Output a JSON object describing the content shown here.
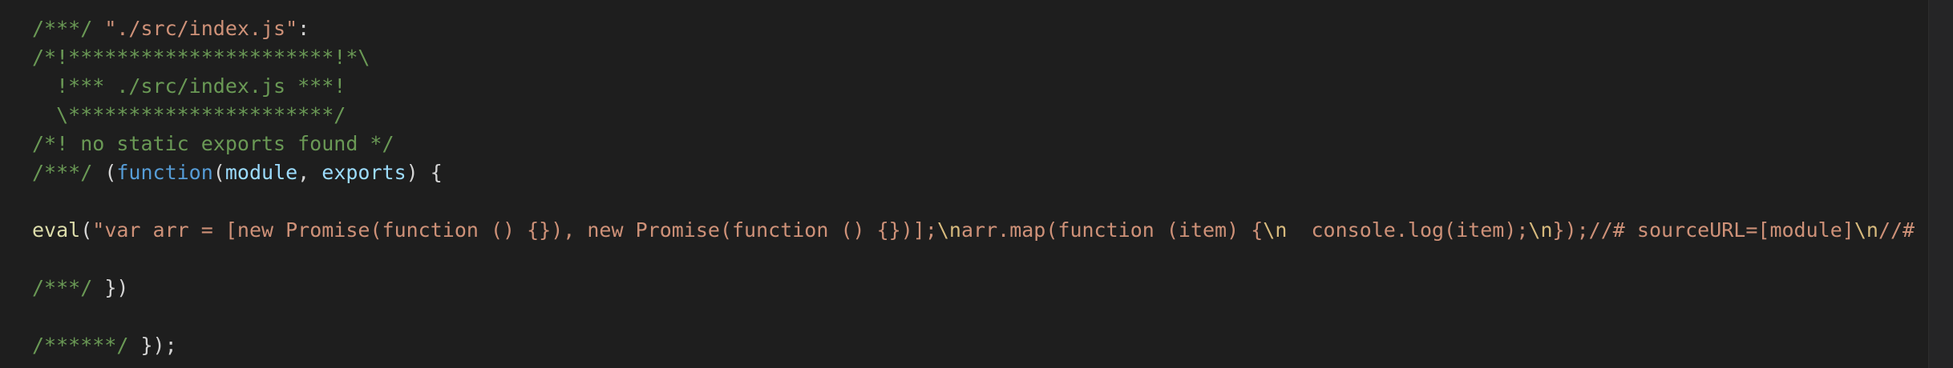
{
  "editor": {
    "background": "#1e1e1e",
    "colors": {
      "comment": "#6a9955",
      "string": "#ce9178",
      "keyword": "#569cd6",
      "param": "#9cdcfe",
      "function": "#dcdcaa",
      "default": "#d4d4d4",
      "escape": "#d7ba7d"
    },
    "lines": [
      [
        {
          "t": "/***/ ",
          "k": "comment"
        },
        {
          "t": "\"./src/index.js\"",
          "k": "string"
        },
        {
          "t": ":",
          "k": "default"
        }
      ],
      [
        {
          "t": "/*!**********************!*\\",
          "k": "comment"
        }
      ],
      [
        {
          "t": "  !*** ./src/index.js ***!",
          "k": "comment"
        }
      ],
      [
        {
          "t": "  \\**********************/",
          "k": "comment"
        }
      ],
      [
        {
          "t": "/*! no static exports found */",
          "k": "comment"
        }
      ],
      [
        {
          "t": "/***/ ",
          "k": "comment"
        },
        {
          "t": "(",
          "k": "default"
        },
        {
          "t": "function",
          "k": "keyword"
        },
        {
          "t": "(",
          "k": "default"
        },
        {
          "t": "module",
          "k": "param"
        },
        {
          "t": ", ",
          "k": "default"
        },
        {
          "t": "exports",
          "k": "param"
        },
        {
          "t": ") {",
          "k": "default"
        }
      ],
      [],
      [
        {
          "t": "eval",
          "k": "function"
        },
        {
          "t": "(",
          "k": "default"
        },
        {
          "t": "\"var arr = [new Promise(function () {}), new Promise(function () {})];",
          "k": "string"
        },
        {
          "t": "\\n",
          "k": "escape"
        },
        {
          "t": "arr.map(function (item) {",
          "k": "string"
        },
        {
          "t": "\\n",
          "k": "escape"
        },
        {
          "t": "  console.log(item);",
          "k": "string"
        },
        {
          "t": "\\n",
          "k": "escape"
        },
        {
          "t": "});//# sourceURL=[module]",
          "k": "string"
        },
        {
          "t": "\\n",
          "k": "escape"
        },
        {
          "t": "//# sourceMa",
          "k": "string"
        }
      ],
      [],
      [
        {
          "t": "/***/ ",
          "k": "comment"
        },
        {
          "t": "})",
          "k": "default"
        }
      ],
      [],
      [
        {
          "t": "/******/ ",
          "k": "comment"
        },
        {
          "t": "});",
          "k": "default"
        }
      ]
    ]
  }
}
